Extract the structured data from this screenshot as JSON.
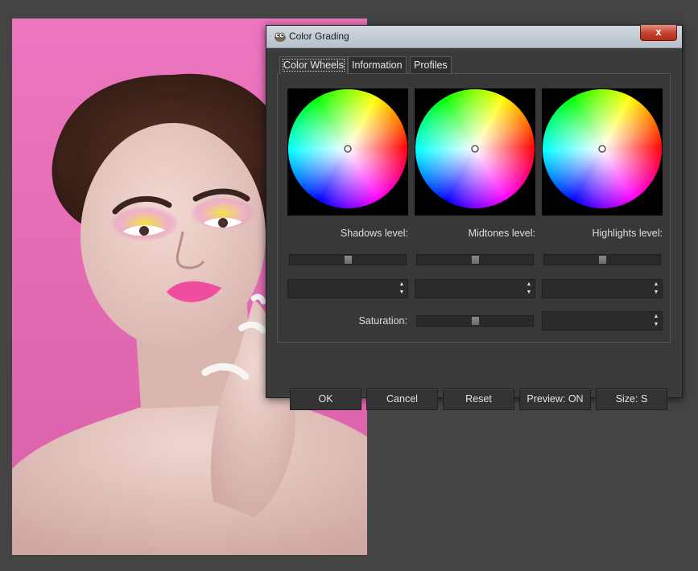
{
  "window": {
    "title": "Color Grading",
    "close_symbol": "x",
    "app_icon": "gimp-wilber-icon"
  },
  "tabs": [
    {
      "label": "Color Wheels",
      "active": true
    },
    {
      "label": "Information",
      "active": false
    },
    {
      "label": "Profiles",
      "active": false
    }
  ],
  "levels": {
    "shadows_label": "Shadows level:",
    "midtones_label": "Midtones level:",
    "highlights_label": "Highlights level:",
    "saturation_label": "Saturation:"
  },
  "sliders": {
    "shadows": 0.5,
    "midtones": 0.5,
    "highlights": 0.5,
    "saturation": 0.5
  },
  "spinboxes": {
    "shadows_value": "",
    "midtones_value": "",
    "highlights_value": "",
    "saturation_value": ""
  },
  "buttons": {
    "ok": "OK",
    "cancel": "Cancel",
    "reset": "Reset",
    "preview": "Preview: ON",
    "size": "Size: S"
  },
  "colors": {
    "workspace_bg": "#444444",
    "photo_bg": "#e871b8",
    "dialog_bg": "#3c3c3c",
    "close_button": "#c4402c"
  }
}
